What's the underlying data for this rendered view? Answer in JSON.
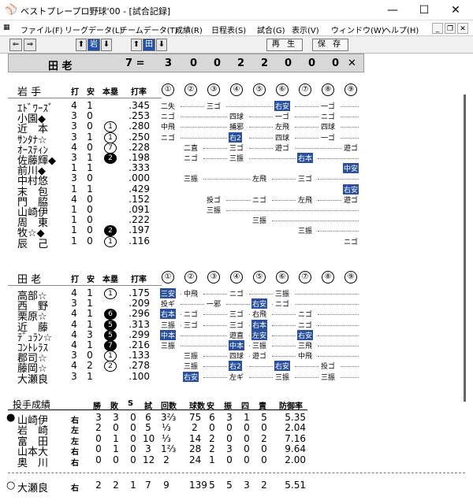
{
  "window": {
    "icon": "baseball-app-icon",
    "title": "ベストプレープロ野球'00 - [試合記録]",
    "minimize": "—",
    "maximize": "☐",
    "close": "✕"
  },
  "menu": [
    "ファイル(F)",
    "リーグデータ(L)",
    "チームデータ(T)",
    "成績(R)",
    "日程表(S)",
    "試合(G)",
    "表示(V)",
    "ウィンドウ(W)",
    "ヘルプ(H)"
  ],
  "mdi": {
    "min": "_",
    "restore": "❐",
    "close": "✕"
  },
  "toolbar": {
    "prev": "⇐",
    "next": "⇒",
    "teamA": "岩",
    "teamB": "田",
    "up": "⬆",
    "down": "⬇",
    "replay": "再 生",
    "save": "保 存"
  },
  "score": {
    "team": "田 老",
    "total": "7 =",
    "innings": [
      "3",
      "0",
      "0",
      "2",
      "2",
      "0",
      "0",
      "0"
    ],
    "last": "✕"
  },
  "innings": [
    "①",
    "②",
    "③",
    "④",
    "⑤",
    "⑥",
    "⑦",
    "⑧",
    "⑨"
  ],
  "iwate": {
    "team": "岩 手",
    "h_ab": "打",
    "h_h": "安",
    "h_hr": "本塁",
    "h_avg": "打率",
    "rows": [
      {
        "name": "ｴﾄﾞﾜｰｽﾞ",
        "ab": "4",
        "h": "1",
        "hr": "",
        "avg": ".345"
      },
      {
        "name": "小園◆",
        "ab": "3",
        "h": "0",
        "hr": "",
        "avg": ".253"
      },
      {
        "name": "近　本",
        "ab": "3",
        "h": "0",
        "hr": "1",
        "avg": ".280"
      },
      {
        "name": "ｻﾝﾀﾅ☆",
        "ab": "3",
        "h": "1",
        "hr": "1",
        "avg": ".250"
      },
      {
        "name": "ｵｰｽﾃｨﾝ",
        "ab": "4",
        "h": "0",
        "hr": "7",
        "avg": ".228"
      },
      {
        "name": "佐藤輝◆",
        "ab": "3",
        "h": "1",
        "hr": "2",
        "avg": ".198"
      },
      {
        "name": "前川◆",
        "ab": "1",
        "h": "1",
        "hr": "",
        "avg": ".333"
      },
      {
        "name": "中村悠",
        "ab": "3",
        "h": "0",
        "hr": "",
        "avg": ".000"
      },
      {
        "name": "末　包",
        "ab": "1",
        "h": "1",
        "hr": "",
        "avg": ".429"
      },
      {
        "name": "門　脇",
        "ab": "4",
        "h": "0",
        "hr": "",
        "avg": ".152"
      },
      {
        "name": "山崎伊",
        "ab": "1",
        "h": "0",
        "hr": "",
        "avg": ".091"
      },
      {
        "name": "周　東",
        "ab": "1",
        "h": "0",
        "hr": "",
        "avg": ".222"
      },
      {
        "name": "牧☆◆",
        "ab": "1",
        "h": "0",
        "hr": "2",
        "avg": ".197"
      },
      {
        "name": "辰　己",
        "ab": "1",
        "h": "0",
        "hr": "1",
        "avg": ".116"
      }
    ],
    "results": [
      [
        "二失",
        "",
        "三ゴ",
        "",
        "",
        "右安",
        "",
        "一ゴ",
        ""
      ],
      [
        "ニゴ",
        "",
        "",
        "四球",
        "",
        "一ゴ",
        "",
        "ニゴ",
        ""
      ],
      [
        "中飛",
        "",
        "",
        "捕邪",
        "",
        "左飛",
        "",
        "四球",
        ""
      ],
      [
        "ニゴ",
        "",
        "",
        "右2",
        "",
        "四球",
        "",
        "一ゴ",
        ""
      ],
      [
        "",
        "二直",
        "",
        "三ゴ",
        "",
        "遊ゴ",
        "",
        "",
        "遊ゴ"
      ],
      [
        "",
        "ニゴ",
        "",
        "三振",
        "",
        "",
        "右本",
        "",
        ""
      ],
      [
        "",
        "",
        "",
        "",
        "",
        "",
        "",
        "",
        "中安"
      ],
      [
        "",
        "三振",
        "",
        "",
        "左飛",
        "",
        "三ゴ",
        "",
        ""
      ],
      [
        "",
        "",
        "",
        "",
        "",
        "",
        "",
        "",
        "右安"
      ],
      [
        "",
        "",
        "投ゴ",
        "",
        "ニゴ",
        "",
        "左飛",
        "",
        "遊ゴ"
      ],
      [
        "",
        "",
        "三振",
        "",
        "",
        "",
        "",
        "",
        ""
      ],
      [
        "",
        "",
        "",
        "",
        "三振",
        "",
        "",
        "",
        ""
      ],
      [
        "",
        "",
        "",
        "",
        "",
        "",
        "三振",
        "",
        ""
      ],
      [
        "",
        "",
        "",
        "",
        "",
        "",
        "",
        "",
        "ニゴ"
      ]
    ]
  },
  "taro": {
    "team": "田 老",
    "h_ab": "打",
    "h_h": "安",
    "h_hr": "本塁",
    "h_avg": "打率",
    "rows": [
      {
        "name": "高部☆",
        "ab": "4",
        "h": "1",
        "hr": "1",
        "avg": ".175"
      },
      {
        "name": "西　野",
        "ab": "3",
        "h": "1",
        "hr": "",
        "avg": ".209"
      },
      {
        "name": "栗原☆",
        "ab": "4",
        "h": "1",
        "hr": "6",
        "avg": ".296"
      },
      {
        "name": "近　藤",
        "ab": "4",
        "h": "1",
        "hr": "5",
        "avg": ".313"
      },
      {
        "name": "ﾃﾞｭﾗﾝ☆",
        "ab": "4",
        "h": "3",
        "hr": "5",
        "avg": ".299"
      },
      {
        "name": "ｺﾝﾄﾚﾗｽ",
        "ab": "4",
        "h": "1",
        "hr": "7",
        "avg": ".216"
      },
      {
        "name": "郡司☆",
        "ab": "3",
        "h": "0",
        "hr": "1",
        "avg": ".133"
      },
      {
        "name": "藤岡☆",
        "ab": "4",
        "h": "2",
        "hr": "2",
        "avg": ".278"
      },
      {
        "name": "大瀬良",
        "ab": "3",
        "h": "1",
        "hr": "",
        "avg": ".100"
      }
    ],
    "results": [
      [
        "三安",
        "中飛",
        "",
        "ニゴ",
        "",
        "三振",
        "",
        "",
        ""
      ],
      [
        "投ギ",
        "",
        "一邪",
        "",
        "右安",
        "ニゴ",
        "",
        "",
        ""
      ],
      [
        "右本",
        "ニゴ",
        "",
        "三ゴ",
        "右飛",
        "",
        "ニゴ",
        "",
        ""
      ],
      [
        "三振",
        "三ゴ",
        "",
        "三ゴ",
        "右本",
        "",
        "ニゴ",
        "",
        ""
      ],
      [
        "中本",
        "",
        "",
        "遊直",
        "左安",
        "",
        "右安",
        "",
        ""
      ],
      [
        "三振",
        "",
        "",
        "中本",
        "三振",
        "",
        "三飛",
        "",
        ""
      ],
      [
        "",
        "三振",
        "",
        "四球",
        "遊ゴ",
        "",
        "中飛",
        "",
        ""
      ],
      [
        "",
        "三振",
        "",
        "右2",
        "",
        "右安",
        "",
        "投ゴ",
        ""
      ],
      [
        "",
        "右安",
        "",
        "左ギ",
        "",
        "三振",
        "",
        "三振",
        ""
      ]
    ]
  },
  "pitching": {
    "title": "投手成績",
    "h_w": "勝",
    "h_l": "敗",
    "h_s": "S",
    "h_g": "試",
    "h_inn": "回数",
    "h_bf": "球数",
    "h_h": "安",
    "h_k": "振",
    "h_bb": "四",
    "h_er": "責",
    "h_era": "防御率",
    "rows": [
      {
        "mark": "●",
        "name": "山崎伊",
        "hand": "右",
        "w": "3",
        "l": "3",
        "s": "0",
        "g": "6",
        "inn": "3⅔",
        "bf": "75",
        "h": "6",
        "k": "3",
        "bb": "1",
        "er": "5",
        "era": "5.35"
      },
      {
        "mark": "",
        "name": "岩　崎",
        "hand": "左",
        "w": "2",
        "l": "0",
        "s": "0",
        "g": "5",
        "inn": "⅓",
        "bf": "2",
        "h": "0",
        "k": "0",
        "bb": "0",
        "er": "0",
        "era": "2.04"
      },
      {
        "mark": "",
        "name": "富　田",
        "hand": "左",
        "w": "0",
        "l": "1",
        "s": "0",
        "g": "10",
        "inn": "⅓",
        "bf": "14",
        "h": "2",
        "k": "0",
        "bb": "0",
        "er": "2",
        "era": "7.16"
      },
      {
        "mark": "",
        "name": "山本大",
        "hand": "右",
        "w": "0",
        "l": "1",
        "s": "0",
        "g": "3",
        "inn": "1⅔",
        "bf": "28",
        "h": "2",
        "k": "3",
        "bb": "0",
        "er": "0",
        "era": "9.64"
      },
      {
        "mark": "",
        "name": "奥　川",
        "hand": "右",
        "w": "0",
        "l": "0",
        "s": "0",
        "g": "12",
        "inn": "2",
        "bf": "24",
        "h": "1",
        "k": "0",
        "bb": "0",
        "er": "0",
        "era": "2.00"
      },
      {
        "mark": "○",
        "name": "大瀬良",
        "hand": "右",
        "w": "2",
        "l": "2",
        "s": "1",
        "g": "7",
        "inn": "9",
        "bf": "139",
        "h": "5",
        "k": "5",
        "bb": "3",
        "er": "2",
        "era": "5.51"
      }
    ]
  }
}
